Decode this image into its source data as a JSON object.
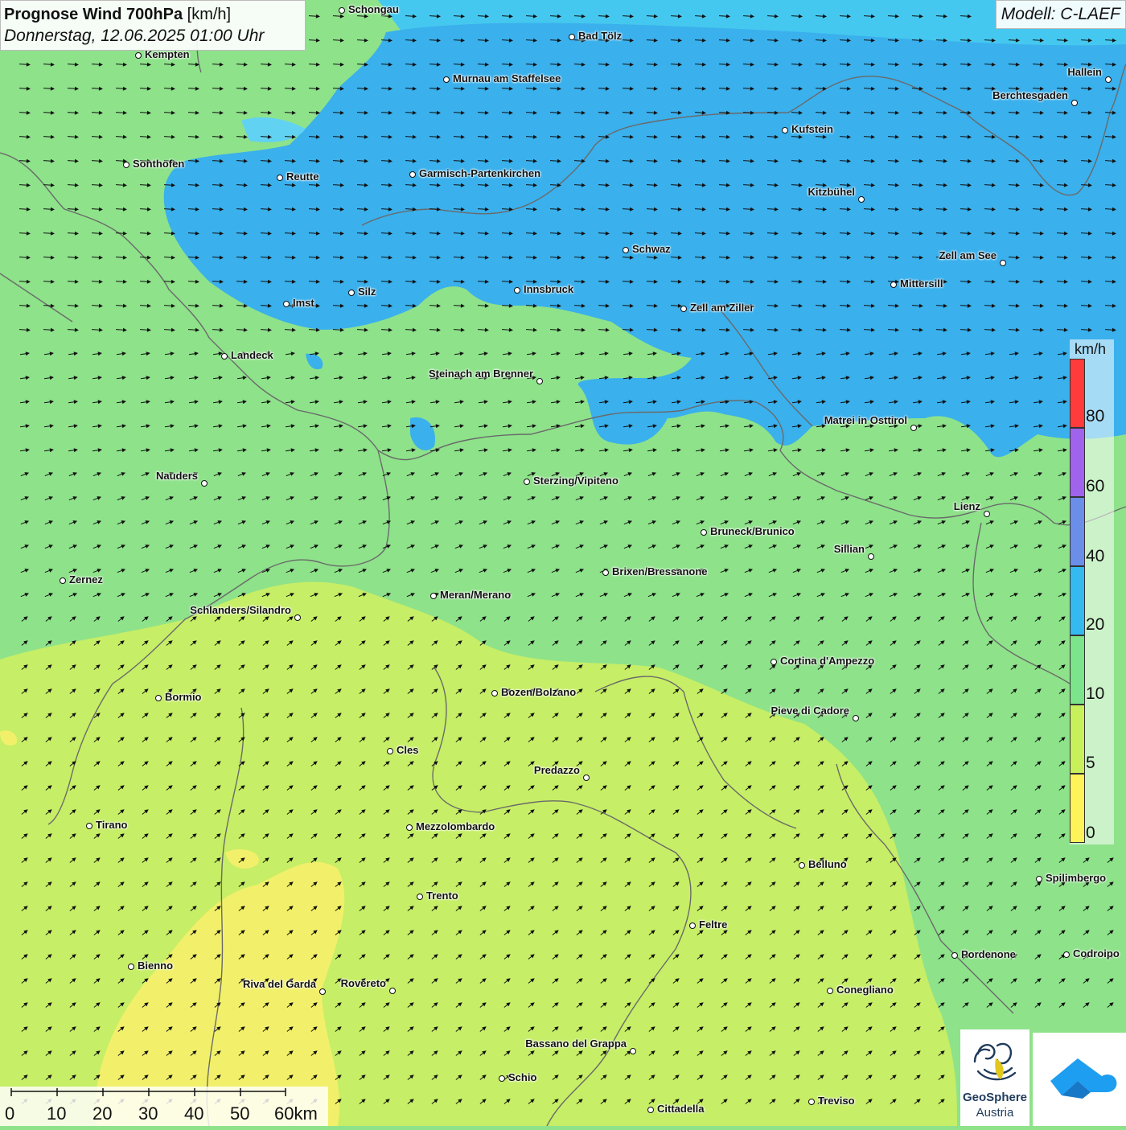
{
  "title": {
    "bold": "Prognose Wind 700hPa",
    "unit": "[km/h]",
    "datetime": "Donnerstag, 12.06.2025 01:00 Uhr"
  },
  "model": "Modell: C-LAEF",
  "legend": {
    "unit": "km/h",
    "labels": [
      "80",
      "60",
      "40",
      "20",
      "10",
      "5",
      "0"
    ],
    "colors": [
      "#ff3b3b",
      "#c8e0f4",
      "#9f63ec",
      "#6b8fe8",
      "#35baf0",
      "#7ce48a",
      "#c8f05a",
      "#fff35a"
    ]
  },
  "scale": {
    "labels": [
      "0",
      "10",
      "20",
      "30",
      "40",
      "50",
      "60km"
    ]
  },
  "logos": {
    "geosphere_line1": "GeoSphere",
    "geosphere_line2": "Austria",
    "geosphere_icon": "geosphere-swirl-icon",
    "app_icon": "weather-app-cloud-icon"
  },
  "wind": {
    "north_zone_speed": "20-40 km/h",
    "north_direction": "east",
    "south_direction": "northeast"
  },
  "cities": [
    {
      "name": "Schongau",
      "side": "r"
    },
    {
      "name": "Bad Tölz",
      "side": "r"
    },
    {
      "name": "Kempten",
      "side": "r"
    },
    {
      "name": "Murnau am Staffelsee",
      "side": "r"
    },
    {
      "name": "Hallein",
      "side": "l"
    },
    {
      "name": "Berchtesgaden",
      "side": "l"
    },
    {
      "name": "Kufstein",
      "side": "r"
    },
    {
      "name": "Sonthofen",
      "side": "r"
    },
    {
      "name": "Reutte",
      "side": "r"
    },
    {
      "name": "Garmisch-Partenkirchen",
      "side": "r"
    },
    {
      "name": "Kitzbühel",
      "side": "l"
    },
    {
      "name": "Schwaz",
      "side": "r"
    },
    {
      "name": "Zell am See",
      "side": "l"
    },
    {
      "name": "Mittersill",
      "side": "r"
    },
    {
      "name": "Innsbruck",
      "side": "r"
    },
    {
      "name": "Silz",
      "side": "r"
    },
    {
      "name": "Imst",
      "side": "r"
    },
    {
      "name": "Zell am Ziller",
      "side": "r"
    },
    {
      "name": "Landeck",
      "side": "r"
    },
    {
      "name": "Steinach am Brenner",
      "side": "l"
    },
    {
      "name": "Matrei in Osttirol",
      "side": "l"
    },
    {
      "name": "Nauders",
      "side": "l"
    },
    {
      "name": "Sterzing/Vipiteno",
      "side": "r"
    },
    {
      "name": "Lienz",
      "side": "l"
    },
    {
      "name": "Bruneck/Brunico",
      "side": "r"
    },
    {
      "name": "Sillian",
      "side": "l"
    },
    {
      "name": "Brixen/Bressanone",
      "side": "r"
    },
    {
      "name": "Zernez",
      "side": "r"
    },
    {
      "name": "Meran/Merano",
      "side": "r"
    },
    {
      "name": "Schlanders/Silandro",
      "side": "l"
    },
    {
      "name": "Cortina d'Ampezzo",
      "side": "r"
    },
    {
      "name": "Bozen/Bolzano",
      "side": "r"
    },
    {
      "name": "Bormio",
      "side": "r"
    },
    {
      "name": "Pieve di Cadore",
      "side": "l"
    },
    {
      "name": "Cles",
      "side": "r"
    },
    {
      "name": "Predazzo",
      "side": "l"
    },
    {
      "name": "Tirano",
      "side": "r"
    },
    {
      "name": "Mezzolombardo",
      "side": "r"
    },
    {
      "name": "Belluno",
      "side": "r"
    },
    {
      "name": "Spilimbergo",
      "side": "r"
    },
    {
      "name": "Trento",
      "side": "r"
    },
    {
      "name": "Feltre",
      "side": "r"
    },
    {
      "name": "Pordenone",
      "side": "r"
    },
    {
      "name": "Codroipo",
      "side": "r"
    },
    {
      "name": "Bienno",
      "side": "r"
    },
    {
      "name": "Riva del Garda",
      "side": "l"
    },
    {
      "name": "Rovereto",
      "side": "l"
    },
    {
      "name": "Conegliano",
      "side": "r"
    },
    {
      "name": "Bassano del Grappa",
      "side": "l"
    },
    {
      "name": "Schio",
      "side": "r"
    },
    {
      "name": "Treviso",
      "side": "r"
    },
    {
      "name": "Cittadella",
      "side": "r"
    }
  ]
}
